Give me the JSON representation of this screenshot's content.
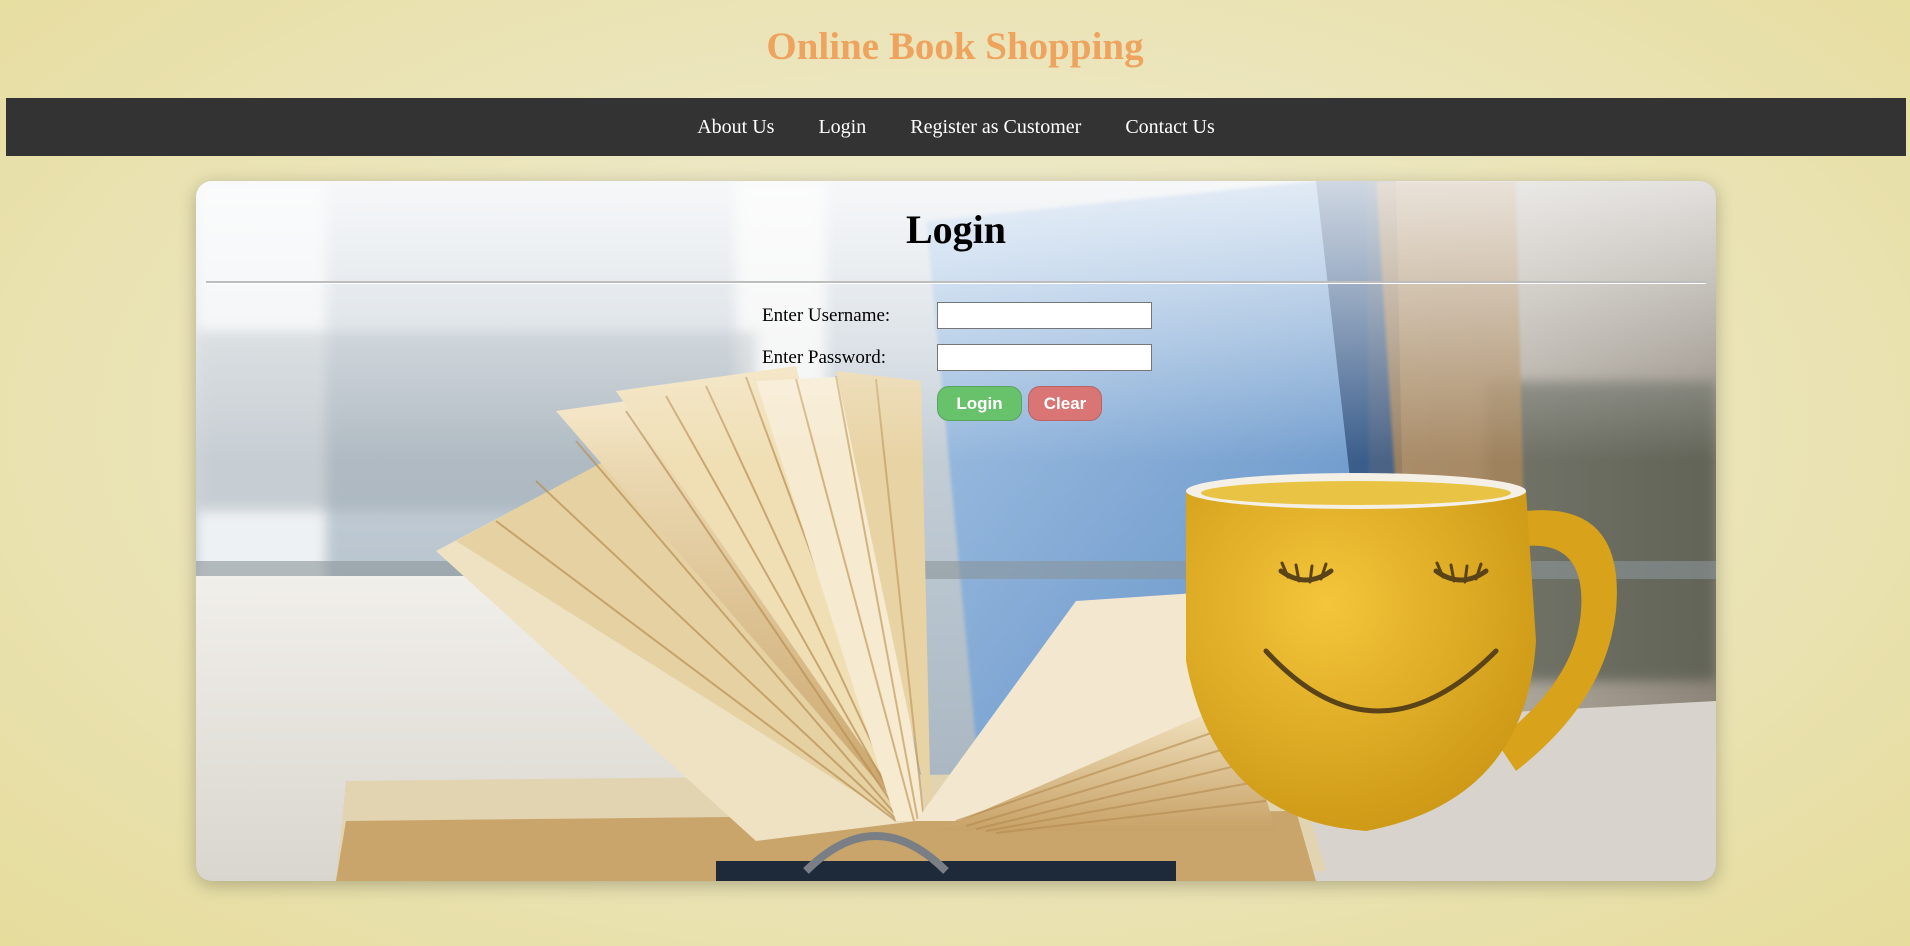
{
  "header": {
    "site_title": "Online Book Shopping"
  },
  "nav": {
    "items": [
      {
        "label": "About Us"
      },
      {
        "label": "Login"
      },
      {
        "label": "Register as Customer"
      },
      {
        "label": "Contact Us"
      }
    ]
  },
  "login_form": {
    "title": "Login",
    "username_label": "Enter Username:",
    "username_value": "",
    "password_label": "Enter Password:",
    "password_value": "",
    "login_button": "Login",
    "clear_button": "Clear"
  },
  "colors": {
    "title_accent": "#eea35e",
    "navbar_bg": "#333333",
    "login_button": "#68c16b",
    "clear_button": "#d97575"
  },
  "background_image": {
    "icon": "book-and-smiley-mug-photo"
  }
}
